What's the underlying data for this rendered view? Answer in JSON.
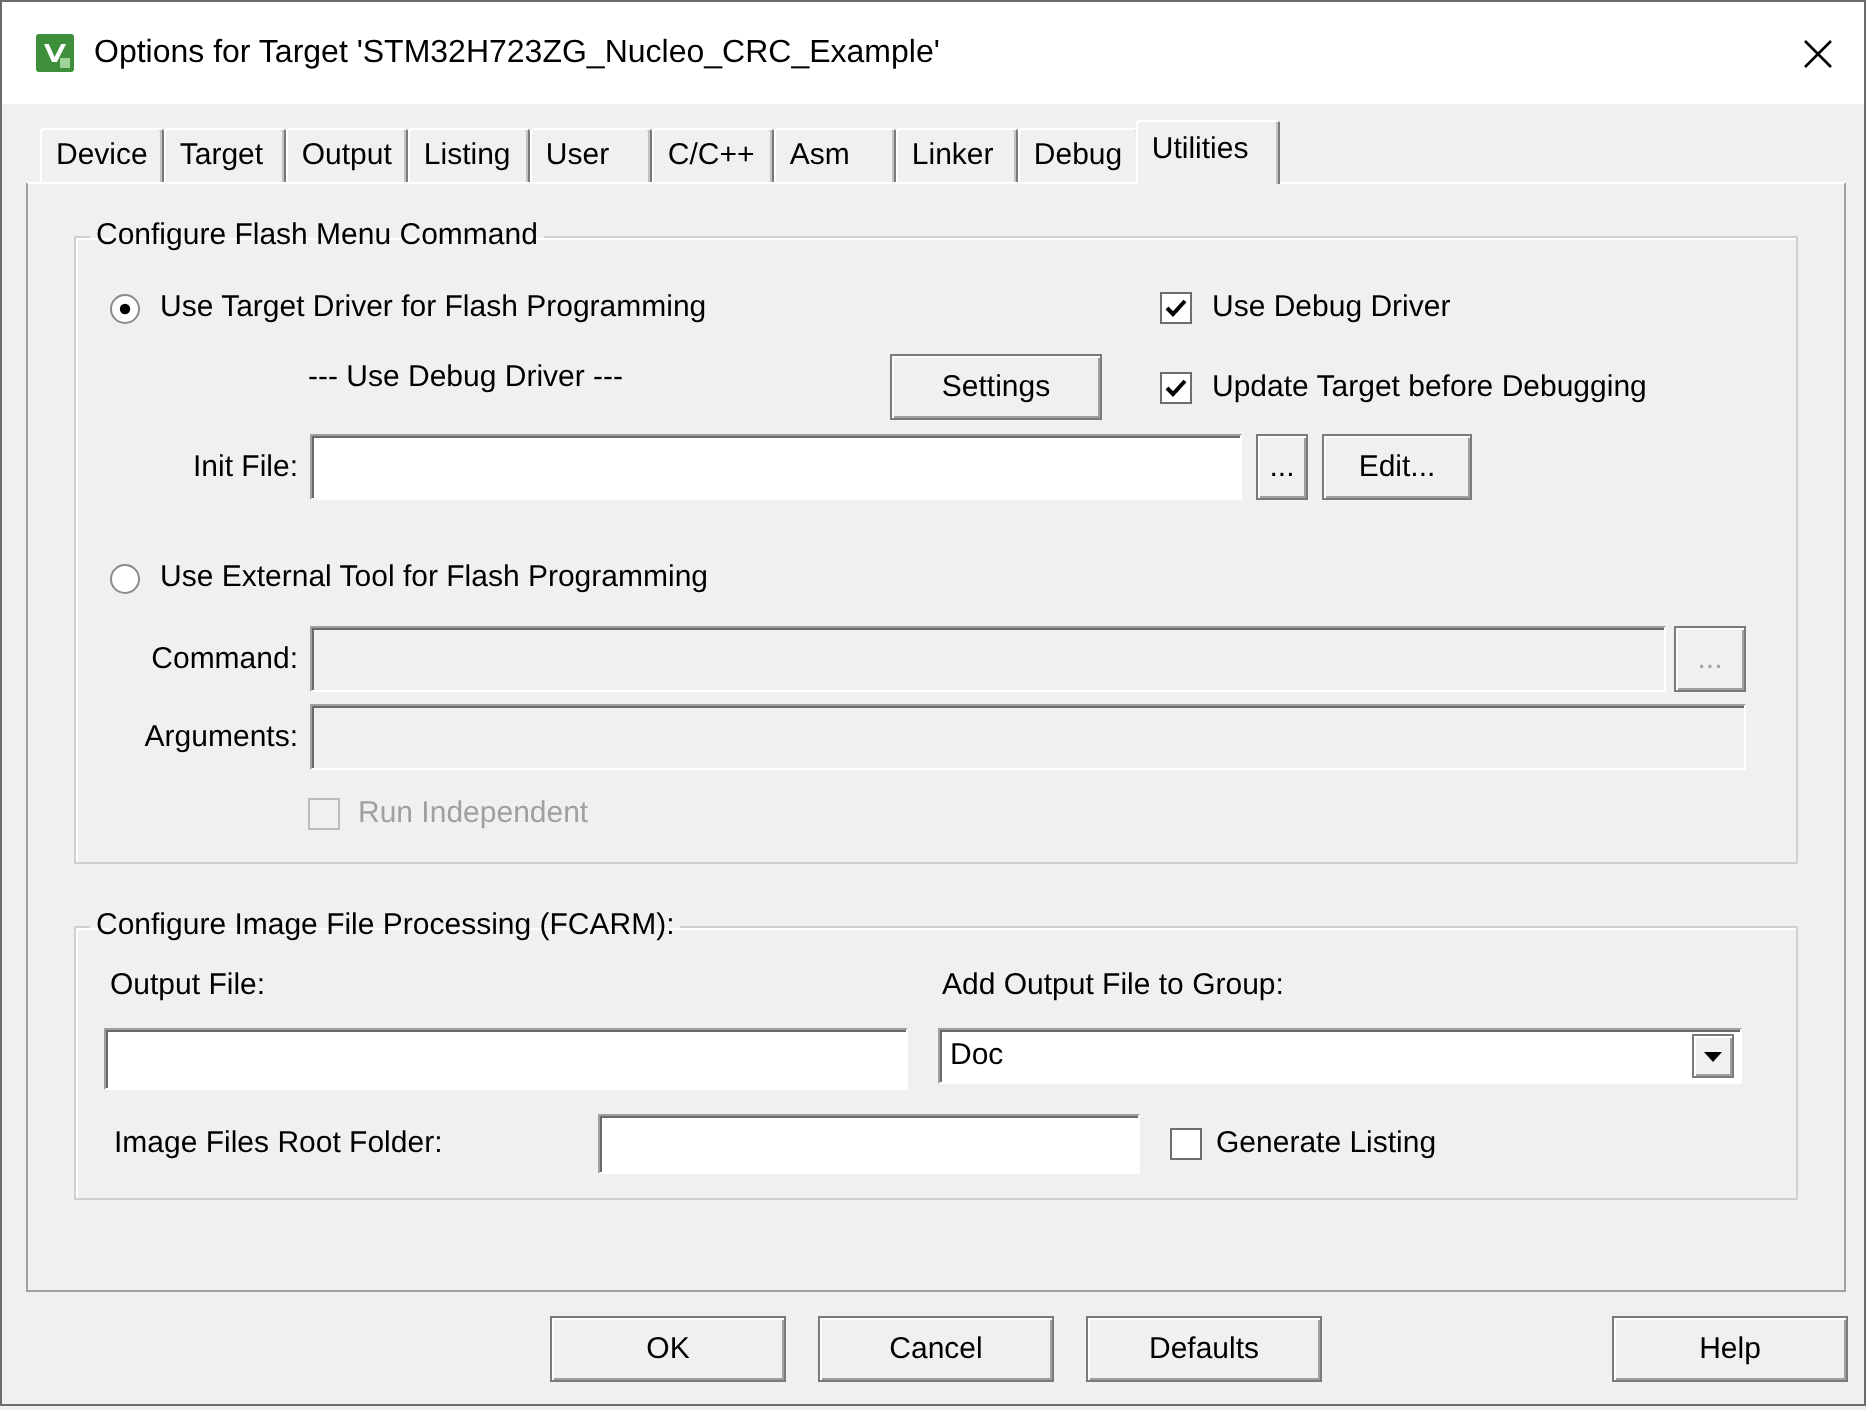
{
  "window": {
    "title": "Options for Target 'STM32H723ZG_Nucleo_CRC_Example'"
  },
  "tabs": [
    {
      "label": "Device",
      "selected": false
    },
    {
      "label": "Target",
      "selected": false
    },
    {
      "label": "Output",
      "selected": false
    },
    {
      "label": "Listing",
      "selected": false
    },
    {
      "label": "User",
      "selected": false
    },
    {
      "label": "C/C++",
      "selected": false
    },
    {
      "label": "Asm",
      "selected": false
    },
    {
      "label": "Linker",
      "selected": false
    },
    {
      "label": "Debug",
      "selected": false
    },
    {
      "label": "Utilities",
      "selected": true
    }
  ],
  "flash_menu": {
    "title": "Configure Flash Menu Command",
    "target_driver": {
      "label": "Use Target Driver for Flash Programming",
      "selected": true
    },
    "driver_note": "--- Use Debug Driver ---",
    "settings_button": "Settings",
    "use_debug_driver": {
      "label": "Use Debug Driver",
      "checked": true
    },
    "update_target": {
      "label": "Update Target before Debugging",
      "checked": true
    },
    "init_file": {
      "label": "Init File:",
      "browse_button": "...",
      "edit_button": "Edit..."
    },
    "external_tool": {
      "label": "Use External Tool for Flash Programming",
      "selected": false
    },
    "command": {
      "label": "Command:",
      "disabled": true,
      "browse_button": "..."
    },
    "arguments": {
      "label": "Arguments:",
      "disabled": true
    },
    "run_independent": {
      "label": "Run Independent",
      "checked": false,
      "disabled": true
    }
  },
  "image_processing": {
    "title": "Configure Image File Processing (FCARM):",
    "output_file": {
      "label": "Output File:"
    },
    "add_to_group": {
      "label": "Add Output File to Group:",
      "value": "Doc"
    },
    "root_folder": {
      "label": "Image Files Root Folder:"
    },
    "generate_listing": {
      "label": "Generate Listing",
      "checked": false
    }
  },
  "buttons": [
    {
      "label": "OK"
    },
    {
      "label": "Cancel"
    },
    {
      "label": "Defaults"
    },
    {
      "label": "Help"
    }
  ]
}
